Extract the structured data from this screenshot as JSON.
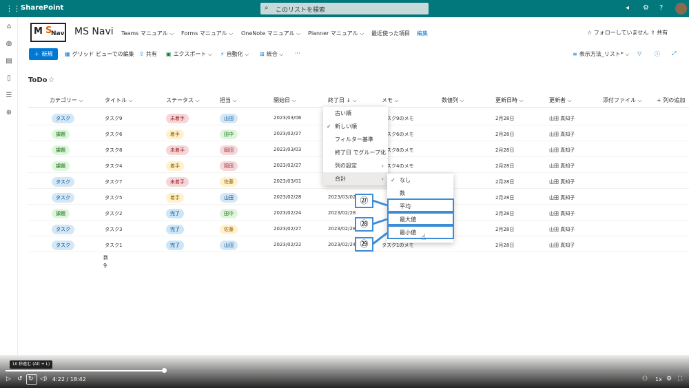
{
  "suitebar": {
    "brand": "SharePoint",
    "search_placeholder": "このリストを検索"
  },
  "site": {
    "logo_text_m": "M",
    "logo_text_s": "S",
    "logo_text_navi": "Navi",
    "title": "MS Navi",
    "nav": [
      "Teams マニュアル ⌵",
      "Forms マニュアル ⌵",
      "OneNote マニュアル ⌵",
      "Planner マニュアル ⌵",
      "最近使った項目"
    ],
    "edit_label": "編集",
    "follow_label": "☆ フォローしていません",
    "share_label": "共有"
  },
  "command_bar": {
    "new_label": "新規",
    "grid_edit": "グリッド ビューでの編集",
    "share": "共有",
    "export": "エクスポート ⌵",
    "automate": "自動化 ⌵",
    "integrate": "統合 ⌵",
    "more": "···",
    "view_options": "表示方法_リスト* ⌵"
  },
  "list": {
    "title": "ToDo",
    "columns": [
      "カテゴリー ⌵",
      "タイトル ⌵",
      "ステータス ⌵",
      "担当 ⌵",
      "開始日 ⌵",
      "終了日 ↓ ⌵",
      "メモ ⌵",
      "数値列 ⌵",
      "更新日時 ⌵",
      "更新者 ⌵",
      "添付ファイル ⌵",
      "+ 列の追加"
    ],
    "rows": [
      {
        "category": "タスク",
        "title": "タスク9",
        "status": "未着手",
        "owner": "山田",
        "start": "2023/03/06",
        "memo": "タスク9のメモ",
        "updated": "2月28日",
        "updater": "山田 真知子"
      },
      {
        "category": "課題",
        "title": "タスク6",
        "status": "着手",
        "owner": "田中",
        "start": "2023/02/27",
        "memo": "タスク6のメモ",
        "updated": "2月28日",
        "updater": "山田 真知子"
      },
      {
        "category": "課題",
        "title": "タスク8",
        "status": "未着手",
        "owner": "岡田",
        "start": "2023/03/03",
        "memo": "タスク8のメモ",
        "updated": "2月28日",
        "updater": "山田 真知子"
      },
      {
        "category": "課題",
        "title": "タスク4",
        "status": "着手",
        "owner": "岡田",
        "start": "2023/02/27",
        "memo": "タスク4のメモ",
        "updated": "2月28日",
        "updater": "山田 真知子"
      },
      {
        "category": "タスク",
        "title": "タスク7",
        "status": "未着手",
        "owner": "佐藤",
        "start": "2023/03/01",
        "memo": "",
        "updated": "2月28日",
        "updater": "山田 真知子"
      },
      {
        "category": "タスク",
        "title": "タスク5",
        "status": "着手",
        "owner": "山田",
        "start": "2023/02/28",
        "end": "2023/03/02",
        "memo": "",
        "updated": "2月28日",
        "updater": "山田 真知子"
      },
      {
        "category": "課題",
        "title": "タスク2",
        "status": "完了",
        "owner": "田中",
        "start": "2023/02/24",
        "end": "2023/02/28",
        "memo": "",
        "updated": "2月28日",
        "updater": "山田 真知子"
      },
      {
        "category": "タスク",
        "title": "タスク3",
        "status": "完了",
        "owner": "佐藤",
        "start": "2023/02/27",
        "end": "2023/02/28",
        "memo": "",
        "updated": "2月28日",
        "updater": "山田 真知子"
      },
      {
        "category": "タスク",
        "title": "タスク1",
        "status": "完了",
        "owner": "山田",
        "start": "2023/02/22",
        "end": "2023/02/24",
        "memo": "タスク1のメモ",
        "updated": "2月28日",
        "updater": "山田 真知子"
      }
    ],
    "count_label": "数",
    "count_value": "9"
  },
  "column_menu": {
    "items": [
      "古い順",
      "新しい順",
      "フィルター基準",
      "終了日 でグループ化",
      "列の設定",
      "合計"
    ],
    "checked_index": 1,
    "selected_index": 5
  },
  "totals_submenu": {
    "items": [
      "なし",
      "数",
      "平均",
      "最大値",
      "最小値"
    ],
    "checked_index": 0
  },
  "annotations": [
    "㉗",
    "㉘",
    "㉙"
  ],
  "player": {
    "tooltip": "10 秒進む (Alt + L)",
    "time": "4:22 / 18:42",
    "speed": "1x",
    "progress_fraction": 0.234
  }
}
